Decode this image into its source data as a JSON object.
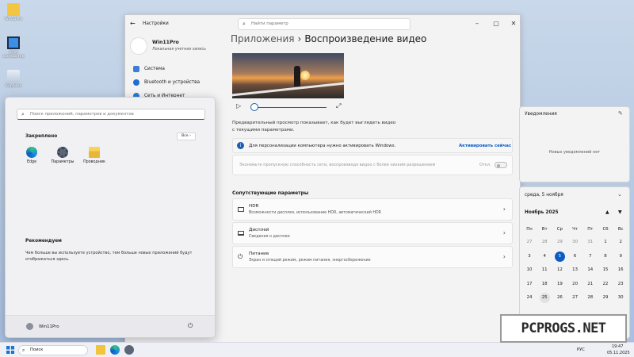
{
  "desktop": {
    "icons": [
      {
        "label": "Win11Pro",
        "icon": "folder-icon"
      },
      {
        "label": "Этот компьютер",
        "icon": "computer-icon"
      },
      {
        "label": "Корзина",
        "icon": "recycle-bin-icon"
      }
    ]
  },
  "settings": {
    "title": "Настройки",
    "search_placeholder": "Найти параметр",
    "profile": {
      "name": "Win11Pro",
      "subtitle": "Локальная учетная запись"
    },
    "nav": [
      {
        "label": "Система",
        "icon": "system-icon",
        "color": "#3a7fd5"
      },
      {
        "label": "Bluetooth и устройства",
        "icon": "bluetooth-icon",
        "color": "#1f6fd1"
      },
      {
        "label": "Сеть и Интернет",
        "icon": "wifi-icon",
        "color": "#2a7bd8"
      }
    ],
    "breadcrumb": {
      "parent": "Приложения",
      "separator": "›",
      "current": "Воспроизведение видео"
    },
    "preview_desc": "Предварительный просмотр показывает, как будет выглядеть видео с текущими параметрами.",
    "activation_banner": {
      "text": "Для персонализации компьютера нужно активировать Windows.",
      "action": "Активировать сейчас"
    },
    "bandwidth": {
      "text": "Экономьте пропускную способность сети, воспроизводя видео с более низким разрешением",
      "state": "Откл."
    },
    "related_title": "Сопутствующие параметры",
    "related": [
      {
        "title": "HDR",
        "subtitle": "Возможности дисплея, использование HDR, автоматический HDR",
        "icon": "hdr-icon"
      },
      {
        "title": "Дисплей",
        "subtitle": "Сведения о дисплее",
        "icon": "display-icon"
      },
      {
        "title": "Питание",
        "subtitle": "Экран и спящий режим, режим питания, энергосбережение",
        "icon": "power-icon"
      }
    ]
  },
  "start_menu": {
    "search_placeholder": "Поиск приложений, параметров и документов",
    "pinned_title": "Закреплено",
    "all_label": "Все",
    "pinned": [
      {
        "label": "Edge",
        "icon": "edge-icon"
      },
      {
        "label": "Параметры",
        "icon": "settings-gear-icon"
      },
      {
        "label": "Проводник",
        "icon": "explorer-folder-icon"
      }
    ],
    "recommended_title": "Рекомендуем",
    "recommended_text": "Чем больше вы используете устройство, тем больше новых приложений будут отображаться здесь.",
    "user": "Win11Pro"
  },
  "notifications": {
    "title": "Уведомления",
    "empty": "Новых уведомлений нет"
  },
  "calendar": {
    "date_header": "среда, 5 ноября",
    "month": "Ноябрь 2025",
    "weekdays": [
      "Пн",
      "Вт",
      "Ср",
      "Чт",
      "Пт",
      "Сб",
      "Вс"
    ],
    "rows": [
      [
        "27",
        "28",
        "29",
        "30",
        "31",
        "1",
        "2"
      ],
      [
        "3",
        "4",
        "5",
        "6",
        "7",
        "8",
        "9"
      ],
      [
        "10",
        "11",
        "12",
        "13",
        "14",
        "15",
        "16"
      ],
      [
        "17",
        "18",
        "19",
        "20",
        "21",
        "22",
        "23"
      ],
      [
        "24",
        "25",
        "26",
        "27",
        "28",
        "29",
        "30"
      ]
    ],
    "today": "5",
    "hovered": "25"
  },
  "taskbar": {
    "search": "Поиск",
    "language": "РУС",
    "time": "19:47",
    "date": "05.11.2025"
  },
  "watermark": "PCPROGS.NET"
}
